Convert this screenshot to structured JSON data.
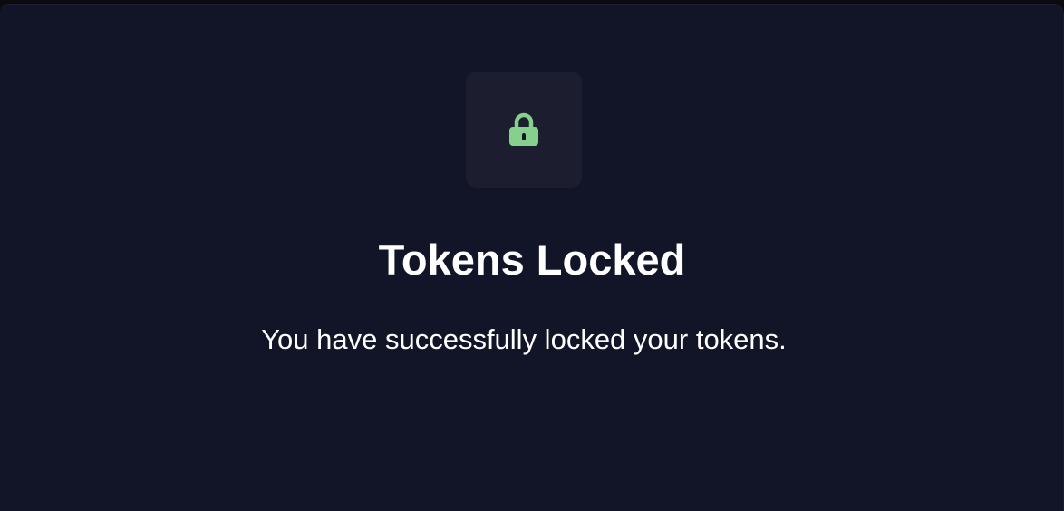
{
  "dialog": {
    "icon": "lock-icon",
    "icon_color": "#86d08e",
    "title": "Tokens Locked",
    "message": "You have successfully locked your tokens."
  },
  "colors": {
    "background": "#121528",
    "tile": "#1c1e2f",
    "text": "#ffffff"
  }
}
